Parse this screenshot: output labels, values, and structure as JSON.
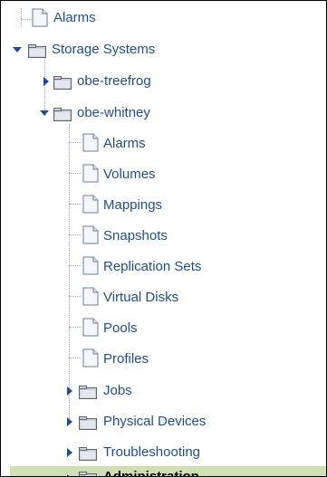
{
  "tree": {
    "items": [
      {
        "label": "Alarms",
        "icon": "document-icon"
      },
      {
        "label": "Storage Systems",
        "icon": "folder-icon",
        "state": "expanded"
      },
      {
        "label": "obe-treefrog",
        "icon": "folder-icon",
        "state": "collapsed"
      },
      {
        "label": "obe-whitney",
        "icon": "folder-icon",
        "state": "expanded"
      },
      {
        "label": "Alarms",
        "icon": "document-icon"
      },
      {
        "label": "Volumes",
        "icon": "document-icon"
      },
      {
        "label": "Mappings",
        "icon": "document-icon"
      },
      {
        "label": "Snapshots",
        "icon": "document-icon"
      },
      {
        "label": "Replication Sets",
        "icon": "document-icon"
      },
      {
        "label": "Virtual Disks",
        "icon": "document-icon"
      },
      {
        "label": "Pools",
        "icon": "document-icon"
      },
      {
        "label": "Profiles",
        "icon": "document-icon"
      },
      {
        "label": "Jobs",
        "icon": "folder-icon",
        "state": "collapsed"
      },
      {
        "label": "Physical Devices",
        "icon": "folder-icon",
        "state": "collapsed"
      },
      {
        "label": "Troubleshooting",
        "icon": "folder-icon",
        "state": "collapsed"
      },
      {
        "label": "Administration",
        "icon": "folder-icon",
        "state": "collapsed",
        "selected": true
      }
    ]
  },
  "colors": {
    "link": "#1f4e8c",
    "selected_bg": "#cfe0b4"
  }
}
